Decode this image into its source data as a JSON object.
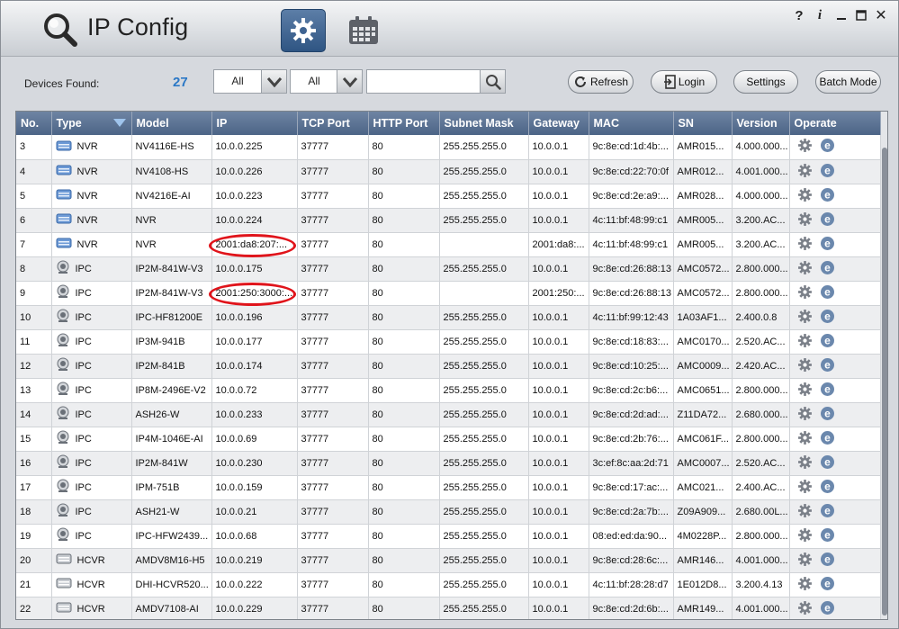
{
  "app": {
    "title": "IP Config"
  },
  "window": {
    "help": "?",
    "info": "i",
    "close": "✕"
  },
  "toolbar": {
    "devices_found_label": "Devices Found:",
    "devices_found_count": "27",
    "filter1": "All",
    "filter2": "All",
    "search_value": "",
    "refresh": "Refresh",
    "login": "Login",
    "settings": "Settings",
    "batch_mode": "Batch Mode"
  },
  "table": {
    "headers": [
      "No.",
      "Type",
      "Model",
      "IP",
      "TCP Port",
      "HTTP Port",
      "Subnet Mask",
      "Gateway",
      "MAC",
      "SN",
      "Version",
      "Operate"
    ],
    "rows": [
      {
        "no": "3",
        "type": "NVR",
        "model": "NV4116E-HS",
        "ip": "10.0.0.225",
        "tcp": "37777",
        "http": "80",
        "mask": "255.255.255.0",
        "gw": "10.0.0.1",
        "mac": "9c:8e:cd:1d:4b:...",
        "sn": "AMR015...",
        "ver": "4.000.000..."
      },
      {
        "no": "4",
        "type": "NVR",
        "model": "NV4108-HS",
        "ip": "10.0.0.226",
        "tcp": "37777",
        "http": "80",
        "mask": "255.255.255.0",
        "gw": "10.0.0.1",
        "mac": "9c:8e:cd:22:70:0f",
        "sn": "AMR012...",
        "ver": "4.001.000..."
      },
      {
        "no": "5",
        "type": "NVR",
        "model": "NV4216E-AI",
        "ip": "10.0.0.223",
        "tcp": "37777",
        "http": "80",
        "mask": "255.255.255.0",
        "gw": "10.0.0.1",
        "mac": "9c:8e:cd:2e:a9:...",
        "sn": "AMR028...",
        "ver": "4.000.000..."
      },
      {
        "no": "6",
        "type": "NVR",
        "model": "NVR",
        "ip": "10.0.0.224",
        "tcp": "37777",
        "http": "80",
        "mask": "255.255.255.0",
        "gw": "10.0.0.1",
        "mac": "4c:11:bf:48:99:c1",
        "sn": "AMR005...",
        "ver": "3.200.AC..."
      },
      {
        "no": "7",
        "type": "NVR",
        "model": "NVR",
        "ip": "2001:da8:207:...",
        "tcp": "37777",
        "http": "80",
        "mask": "",
        "gw": "2001:da8:...",
        "mac": "4c:11:bf:48:99:c1",
        "sn": "AMR005...",
        "ver": "3.200.AC..."
      },
      {
        "no": "8",
        "type": "IPC",
        "model": "IP2M-841W-V3",
        "ip": "10.0.0.175",
        "tcp": "37777",
        "http": "80",
        "mask": "255.255.255.0",
        "gw": "10.0.0.1",
        "mac": "9c:8e:cd:26:88:13",
        "sn": "AMC0572...",
        "ver": "2.800.000..."
      },
      {
        "no": "9",
        "type": "IPC",
        "model": "IP2M-841W-V3",
        "ip": "2001:250:3000:...",
        "tcp": "37777",
        "http": "80",
        "mask": "",
        "gw": "2001:250:...",
        "mac": "9c:8e:cd:26:88:13",
        "sn": "AMC0572...",
        "ver": "2.800.000..."
      },
      {
        "no": "10",
        "type": "IPC",
        "model": "IPC-HF81200E",
        "ip": "10.0.0.196",
        "tcp": "37777",
        "http": "80",
        "mask": "255.255.255.0",
        "gw": "10.0.0.1",
        "mac": "4c:11:bf:99:12:43",
        "sn": "1A03AF1...",
        "ver": "2.400.0.8"
      },
      {
        "no": "11",
        "type": "IPC",
        "model": "IP3M-941B",
        "ip": "10.0.0.177",
        "tcp": "37777",
        "http": "80",
        "mask": "255.255.255.0",
        "gw": "10.0.0.1",
        "mac": "9c:8e:cd:18:83:...",
        "sn": "AMC0170...",
        "ver": "2.520.AC..."
      },
      {
        "no": "12",
        "type": "IPC",
        "model": "IP2M-841B",
        "ip": "10.0.0.174",
        "tcp": "37777",
        "http": "80",
        "mask": "255.255.255.0",
        "gw": "10.0.0.1",
        "mac": "9c:8e:cd:10:25:...",
        "sn": "AMC0009...",
        "ver": "2.420.AC..."
      },
      {
        "no": "13",
        "type": "IPC",
        "model": "IP8M-2496E-V2",
        "ip": "10.0.0.72",
        "tcp": "37777",
        "http": "80",
        "mask": "255.255.255.0",
        "gw": "10.0.0.1",
        "mac": "9c:8e:cd:2c:b6:...",
        "sn": "AMC0651...",
        "ver": "2.800.000..."
      },
      {
        "no": "14",
        "type": "IPC",
        "model": "ASH26-W",
        "ip": "10.0.0.233",
        "tcp": "37777",
        "http": "80",
        "mask": "255.255.255.0",
        "gw": "10.0.0.1",
        "mac": "9c:8e:cd:2d:ad:...",
        "sn": "Z11DA72...",
        "ver": "2.680.000..."
      },
      {
        "no": "15",
        "type": "IPC",
        "model": "IP4M-1046E-AI",
        "ip": "10.0.0.69",
        "tcp": "37777",
        "http": "80",
        "mask": "255.255.255.0",
        "gw": "10.0.0.1",
        "mac": "9c:8e:cd:2b:76:...",
        "sn": "AMC061F...",
        "ver": "2.800.000..."
      },
      {
        "no": "16",
        "type": "IPC",
        "model": "IP2M-841W",
        "ip": "10.0.0.230",
        "tcp": "37777",
        "http": "80",
        "mask": "255.255.255.0",
        "gw": "10.0.0.1",
        "mac": "3c:ef:8c:aa:2d:71",
        "sn": "AMC0007...",
        "ver": "2.520.AC..."
      },
      {
        "no": "17",
        "type": "IPC",
        "model": "IPM-751B",
        "ip": "10.0.0.159",
        "tcp": "37777",
        "http": "80",
        "mask": "255.255.255.0",
        "gw": "10.0.0.1",
        "mac": "9c:8e:cd:17:ac:...",
        "sn": "AMC021...",
        "ver": "2.400.AC..."
      },
      {
        "no": "18",
        "type": "IPC",
        "model": "ASH21-W",
        "ip": "10.0.0.21",
        "tcp": "37777",
        "http": "80",
        "mask": "255.255.255.0",
        "gw": "10.0.0.1",
        "mac": "9c:8e:cd:2a:7b:...",
        "sn": "Z09A909...",
        "ver": "2.680.00L..."
      },
      {
        "no": "19",
        "type": "IPC",
        "model": "IPC-HFW2439...",
        "ip": "10.0.0.68",
        "tcp": "37777",
        "http": "80",
        "mask": "255.255.255.0",
        "gw": "10.0.0.1",
        "mac": "08:ed:ed:da:90...",
        "sn": "4M0228P...",
        "ver": "2.800.000..."
      },
      {
        "no": "20",
        "type": "HCVR",
        "model": "AMDV8M16-H5",
        "ip": "10.0.0.219",
        "tcp": "37777",
        "http": "80",
        "mask": "255.255.255.0",
        "gw": "10.0.0.1",
        "mac": "9c:8e:cd:28:6c:...",
        "sn": "AMR146...",
        "ver": "4.001.000..."
      },
      {
        "no": "21",
        "type": "HCVR",
        "model": "DHI-HCVR520...",
        "ip": "10.0.0.222",
        "tcp": "37777",
        "http": "80",
        "mask": "255.255.255.0",
        "gw": "10.0.0.1",
        "mac": "4c:11:bf:28:28:d7",
        "sn": "1E012D8...",
        "ver": "3.200.4.13"
      },
      {
        "no": "22",
        "type": "HCVR",
        "model": "AMDV7108-AI",
        "ip": "10.0.0.229",
        "tcp": "37777",
        "http": "80",
        "mask": "255.255.255.0",
        "gw": "10.0.0.1",
        "mac": "9c:8e:cd:2d:6b:...",
        "sn": "AMR149...",
        "ver": "4.001.000..."
      }
    ]
  },
  "colors": {
    "accent": "#2b78c6",
    "header_bg": "#5a7193",
    "highlight": "#e0141b"
  }
}
